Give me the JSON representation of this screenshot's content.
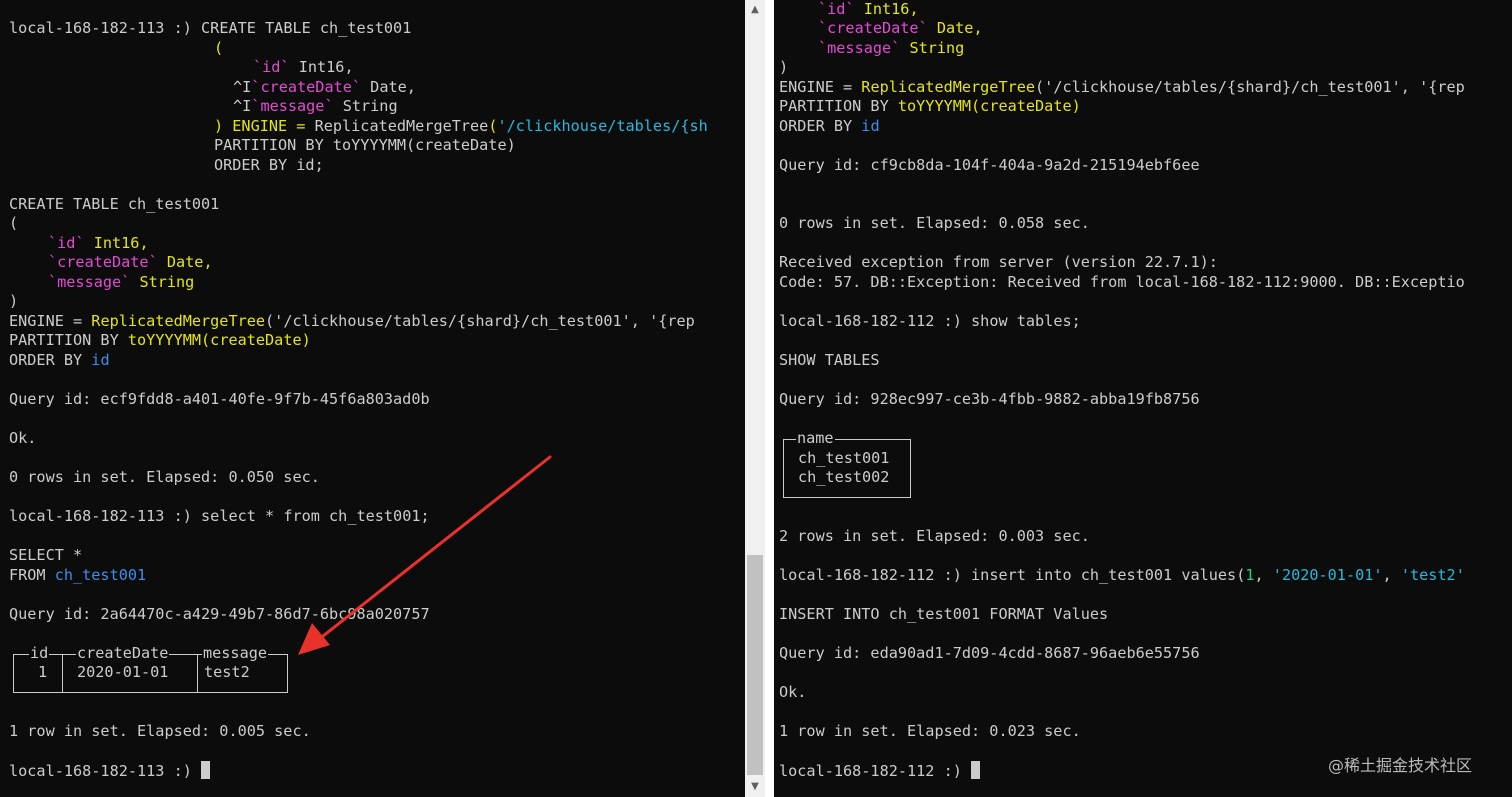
{
  "left_terminal": {
    "prompt_host": "local-168-182-113 :) ",
    "cmd1": "CREATE TABLE ch_test001",
    "cmd1_paren": "(",
    "cmd1_f1_name": "`id`",
    "cmd1_f1_type": " Int16,",
    "cmd1_f2_prefix": "^I",
    "cmd1_f2_name": "`createDate`",
    "cmd1_f2_type": " Date,",
    "cmd1_f3_prefix": "^I",
    "cmd1_f3_name": "`message`",
    "cmd1_f3_type": " String",
    "cmd1_engine_a": ") ENGINE = ",
    "cmd1_engine_fn": "ReplicatedMergeTree",
    "cmd1_engine_paren": "(",
    "cmd1_engine_path": "'/clickhouse/tables/{sh",
    "cmd1_partition": "PARTITION BY toYYYYMM(createDate)",
    "cmd1_order": "ORDER BY id;",
    "echo_create": "CREATE TABLE ch_test001",
    "echo_open": "(",
    "echo_f1_name": "`id`",
    "echo_f1_type": " Int16,",
    "echo_f2_name": "`createDate`",
    "echo_f2_type": " Date,",
    "echo_f3_name": "`message`",
    "echo_f3_type": " String",
    "echo_close": ")",
    "echo_engine_a": "ENGINE = ",
    "echo_engine_fn": "ReplicatedMergeTree",
    "echo_engine_rest": "('/clickhouse/tables/{shard}/ch_test001', '{rep",
    "echo_partition_a": "PARTITION BY ",
    "echo_partition_fn": "toYYYYMM",
    "echo_partition_arg": "(createDate)",
    "echo_order_a": "ORDER BY ",
    "echo_order_col": "id",
    "query_id_1": "Query id: ecf9fdd8-a401-40fe-9f7b-45f6a803ad0b",
    "ok": "Ok.",
    "rows_1": "0 rows in set. Elapsed: 0.050 sec.",
    "cmd2": "select * from ch_test001;",
    "echo_select": "SELECT *",
    "echo_from_a": "FROM ",
    "echo_from_tbl": "ch_test001",
    "query_id_2": "Query id: 2a64470c-a429-49b7-86d7-6bc98a020757",
    "result_table": {
      "headers": [
        "id",
        "createDate",
        "message"
      ],
      "row": [
        "1",
        "2020-01-01",
        "test2"
      ]
    },
    "rows_2": "1 row in set. Elapsed: 0.005 sec.",
    "final_prompt": "local-168-182-113 :) "
  },
  "right_terminal": {
    "f1_name": "`id`",
    "f1_type": " Int16,",
    "f2_name": "`createDate`",
    "f2_type": " Date,",
    "f3_name": "`message`",
    "f3_type": " String",
    "close": ")",
    "engine_a": "ENGINE = ",
    "engine_fn": "ReplicatedMergeTree",
    "engine_rest": "('/clickhouse/tables/{shard}/ch_test001', '{rep",
    "partition_a": "PARTITION BY ",
    "partition_fn": "toYYYYMM",
    "partition_arg": "(createDate)",
    "order_a": "ORDER BY ",
    "order_col": "id",
    "query_id_1": "Query id: cf9cb8da-104f-404a-9a2d-215194ebf6ee",
    "rows_1": "0 rows in set. Elapsed: 0.058 sec.",
    "exception_1": "Received exception from server (version 22.7.1):",
    "exception_2": "Code: 57. DB::Exception: Received from local-168-182-112:9000. DB::Exceptio",
    "prompt_host": "local-168-182-112 :) ",
    "cmd_show": "show tables;",
    "echo_show": "SHOW TABLES",
    "query_id_2": "Query id: 928ec997-ce3b-4fbb-9882-abba19fb8756",
    "tables_table": {
      "header": "name",
      "rows": [
        "ch_test001",
        "ch_test002"
      ]
    },
    "rows_2": "2 rows in set. Elapsed: 0.003 sec.",
    "cmd_insert_a": "insert into ch_test001 values(",
    "cmd_insert_1": "1",
    "cmd_insert_sep1": ", ",
    "cmd_insert_date": "'2020-01-01'",
    "cmd_insert_sep2": ", ",
    "cmd_insert_msg": "'test2'",
    "echo_insert": "INSERT INTO ch_test001 FORMAT Values",
    "query_id_3": "Query id: eda90ad1-7d09-4cdd-8687-96aeb6e55756",
    "ok": "Ok.",
    "rows_3": "1 row in set. Elapsed: 0.023 sec.",
    "final_prompt": "local-168-182-112 :) "
  },
  "watermark": "@稀土掘金技术社区",
  "colors": {
    "background": "#0c0c0c",
    "text": "#cccccc",
    "keyword_yellow": "#e5e510",
    "identifier_blue": "#3b8eea",
    "string_cyan": "#29b8db",
    "field_magenta": "#e34ad3",
    "arrow_red": "#e8322b"
  },
  "icons": [
    "scroll-up-arrow-icon",
    "scroll-down-arrow-icon",
    "red-annotation-arrow-icon",
    "cursor-block-icon"
  ]
}
